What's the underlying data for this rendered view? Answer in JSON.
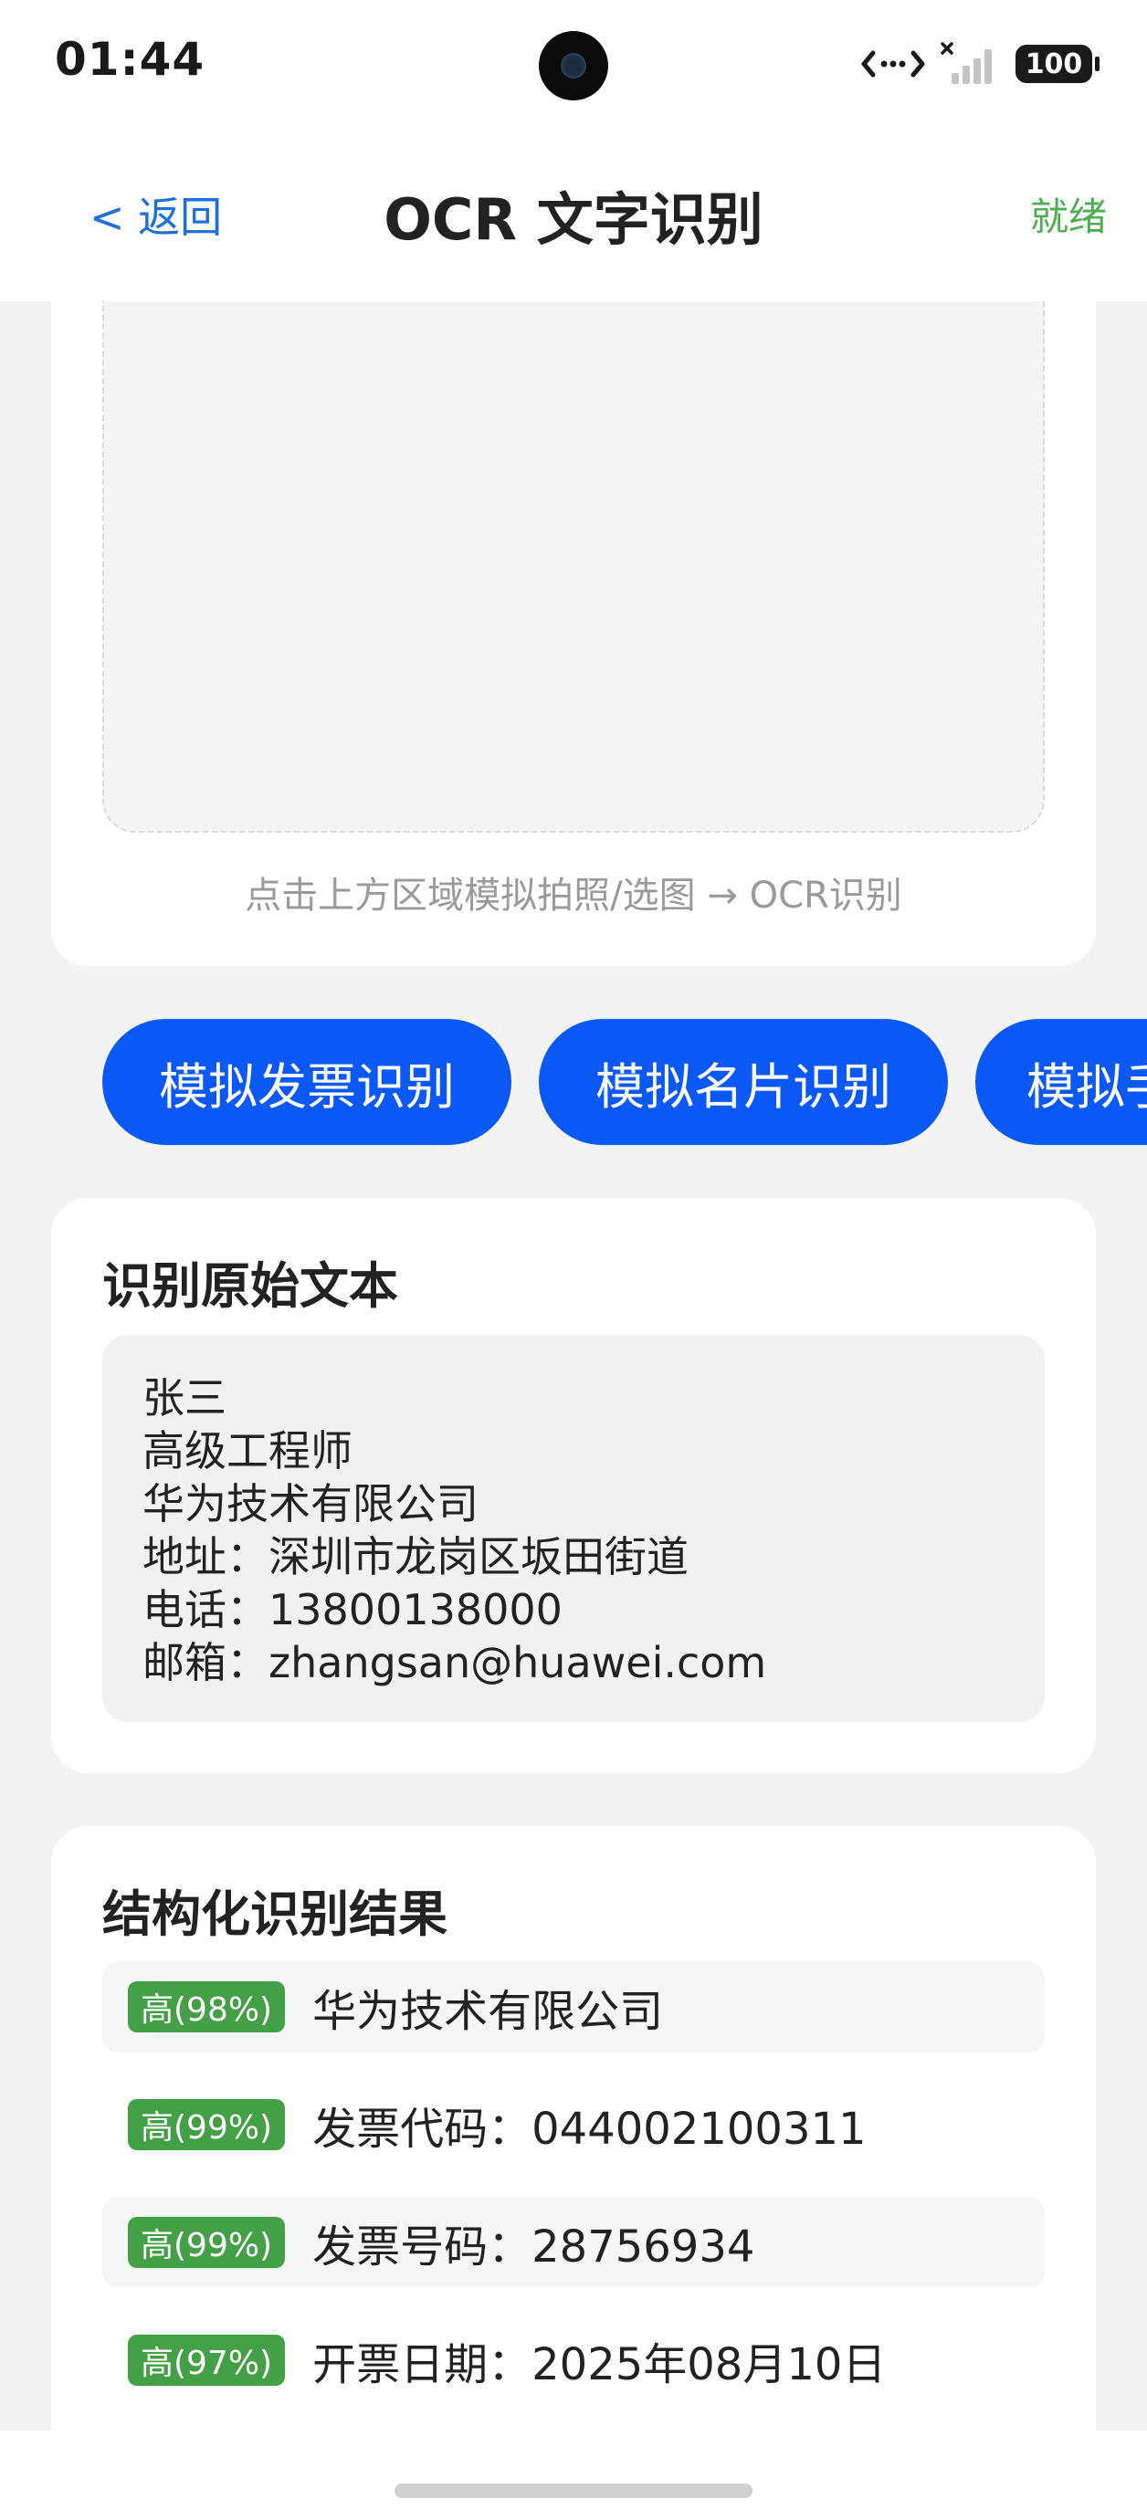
{
  "status_bar": {
    "time": "01:44",
    "battery": "100"
  },
  "nav": {
    "back_label": "< 返回",
    "title": "OCR 文字识别",
    "status": "就绪"
  },
  "image_area": {
    "hint": "点击上方区域模拟拍照/选图 → OCR识别"
  },
  "actions": [
    {
      "label": "模拟发票识别"
    },
    {
      "label": "模拟名片识别"
    },
    {
      "label": "模拟手"
    }
  ],
  "raw_text": {
    "title": "识别原始文本",
    "lines": [
      "张三",
      "高级工程师",
      "华为技术有限公司",
      "地址：深圳市龙岗区坂田街道",
      "电话：13800138000",
      "邮箱：zhangsan@huawei.com"
    ]
  },
  "structured": {
    "title": "结构化识别结果",
    "results": [
      {
        "confidence": "高(98%)",
        "text": "华为技术有限公司"
      },
      {
        "confidence": "高(99%)",
        "text": "发票代码：044002100311"
      },
      {
        "confidence": "高(99%)",
        "text": "发票号码：28756934"
      },
      {
        "confidence": "高(97%)",
        "text": "开票日期：2025年08月10日"
      }
    ]
  },
  "colors": {
    "primary": "#0a59f7",
    "back_link": "#1e6fd9",
    "ready_status": "#4caf50",
    "confidence_badge": "#43a047"
  }
}
